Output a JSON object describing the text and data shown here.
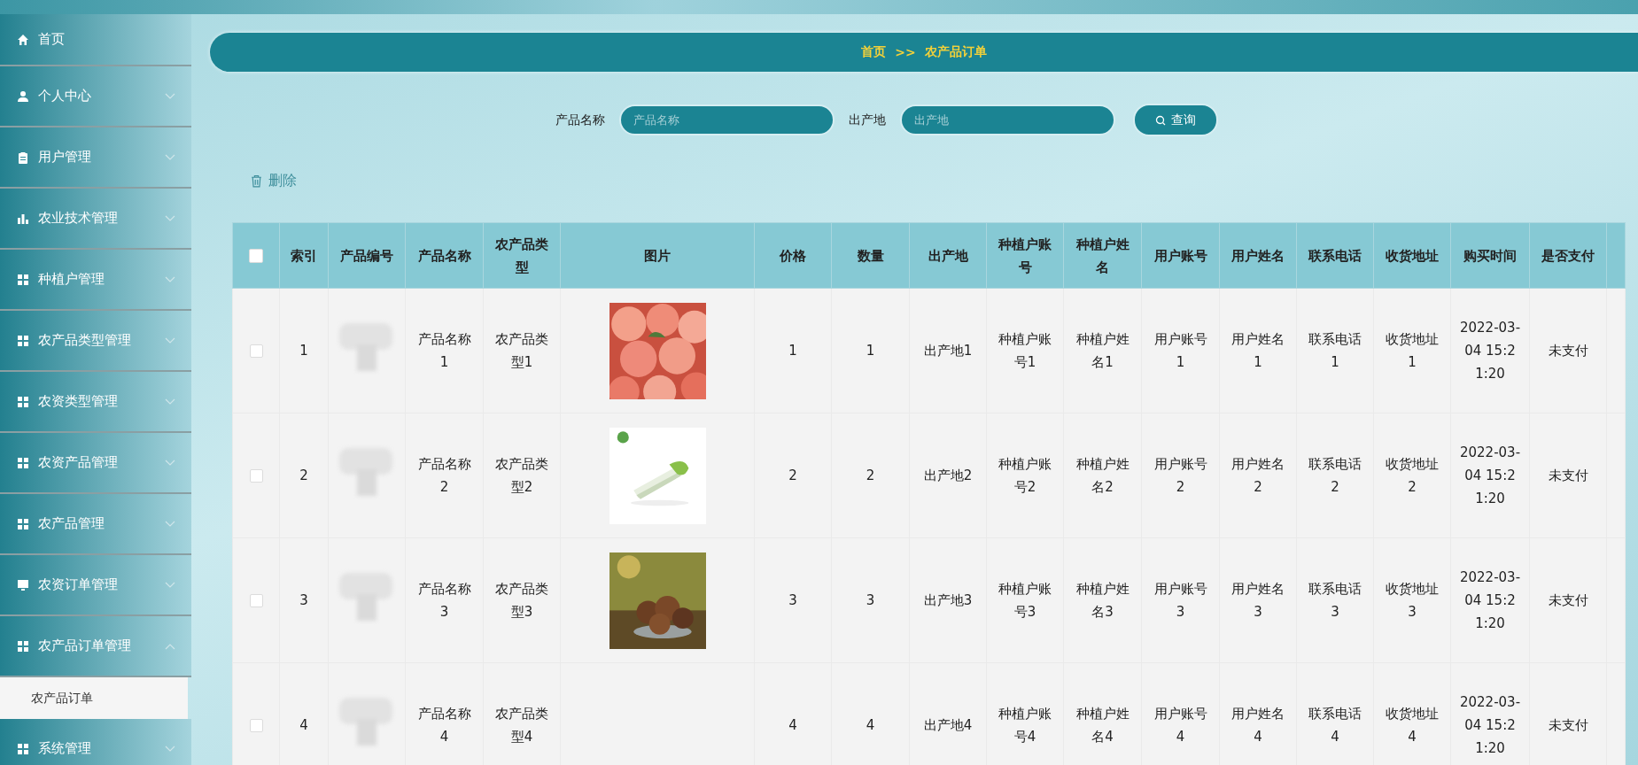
{
  "sidebar": {
    "items": [
      {
        "label": "首页"
      },
      {
        "label": "个人中心",
        "expandable": true,
        "expanded": false
      },
      {
        "label": "用户管理",
        "expandable": true,
        "expanded": false
      },
      {
        "label": "农业技术管理",
        "expandable": true,
        "expanded": false
      },
      {
        "label": "种植户管理",
        "expandable": true,
        "expanded": false
      },
      {
        "label": "农产品类型管理",
        "expandable": true,
        "expanded": false
      },
      {
        "label": "农资类型管理",
        "expandable": true,
        "expanded": false
      },
      {
        "label": "农资产品管理",
        "expandable": true,
        "expanded": false
      },
      {
        "label": "农产品管理",
        "expandable": true,
        "expanded": false
      },
      {
        "label": "农资订单管理",
        "expandable": true,
        "expanded": false
      },
      {
        "label": "农产品订单管理",
        "expandable": true,
        "expanded": true,
        "children": [
          {
            "label": "农产品订单",
            "selected": true
          }
        ]
      },
      {
        "label": "系统管理",
        "expandable": true,
        "expanded": false
      }
    ]
  },
  "breadcrumb": [
    "首页",
    ">>",
    "农产品订单"
  ],
  "search": {
    "fields": [
      {
        "label": "产品名称",
        "placeholder": "产品名称"
      },
      {
        "label": "出产地",
        "placeholder": "出产地"
      }
    ],
    "button": "查询"
  },
  "toolbar": {
    "delete": "删除"
  },
  "table": {
    "all_checked": false,
    "columns": [
      "索引",
      "产品编号",
      "产品名称",
      "农产品类型",
      "图片",
      "价格",
      "数量",
      "出产地",
      "种植户账号",
      "种植户姓名",
      "用户账号",
      "用户姓名",
      "联系电话",
      "收货地址",
      "购买时间",
      "是否支付"
    ],
    "rows": [
      {
        "checked": false,
        "index": "1",
        "name": "产品名称1",
        "type": "农产品类型1",
        "price": "1",
        "qty": "1",
        "origin": "出产地1",
        "grower_account": "种植户账号1",
        "grower_name": "种植户姓名1",
        "user_account": "用户账号1",
        "user_name": "用户姓名1",
        "phone": "联系电话1",
        "address": "收货地址1",
        "time": "2022-03-04 15:21:20",
        "paid": "未支付"
      },
      {
        "checked": false,
        "index": "2",
        "name": "产品名称2",
        "type": "农产品类型2",
        "price": "2",
        "qty": "2",
        "origin": "出产地2",
        "grower_account": "种植户账号2",
        "grower_name": "种植户姓名2",
        "user_account": "用户账号2",
        "user_name": "用户姓名2",
        "phone": "联系电话2",
        "address": "收货地址2",
        "time": "2022-03-04 15:21:20",
        "paid": "未支付"
      },
      {
        "checked": false,
        "index": "3",
        "name": "产品名称3",
        "type": "农产品类型3",
        "price": "3",
        "qty": "3",
        "origin": "出产地3",
        "grower_account": "种植户账号3",
        "grower_name": "种植户姓名3",
        "user_account": "用户账号3",
        "user_name": "用户姓名3",
        "phone": "联系电话3",
        "address": "收货地址3",
        "time": "2022-03-04 15:21:20",
        "paid": "未支付"
      },
      {
        "checked": false,
        "index": "4",
        "name": "产品名称4",
        "type": "农产品类型4",
        "price": "4",
        "qty": "4",
        "origin": "出产地4",
        "grower_account": "种植户账号4",
        "grower_name": "种植户姓名4",
        "user_account": "用户账号4",
        "user_name": "用户姓名4",
        "phone": "联系电话4",
        "address": "收货地址4",
        "time": "2022-03-04 15:21:20",
        "paid": "未支付"
      }
    ]
  }
}
